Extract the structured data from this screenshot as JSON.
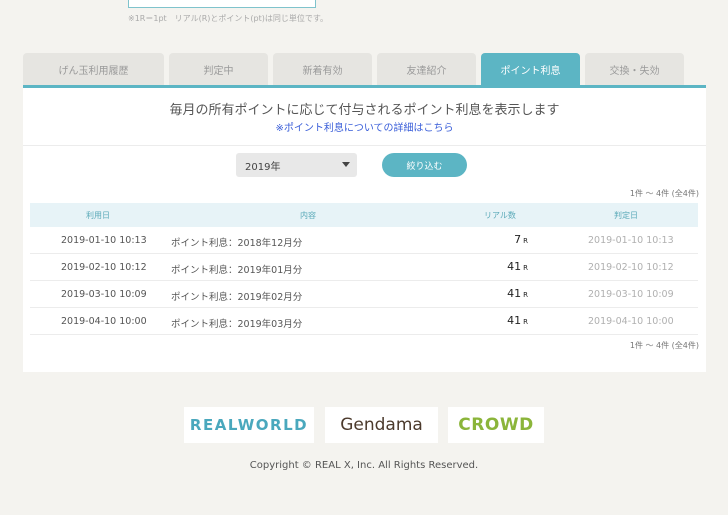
{
  "header": {
    "note": "※1R＝1pt　リアル(R)とポイント(pt)は同じ単位です。"
  },
  "tabs": [
    {
      "label": "げん玉利用履歴",
      "active": false
    },
    {
      "label": "判定中",
      "active": false
    },
    {
      "label": "新着有効",
      "active": false
    },
    {
      "label": "友達紹介",
      "active": false
    },
    {
      "label": "ポイント利息",
      "active": true
    },
    {
      "label": "交換・失効",
      "active": false
    }
  ],
  "panel": {
    "title": "毎月の所有ポイントに応じて付与されるポイント利息を表示します",
    "link": "※ポイント利息についての詳細はこちら"
  },
  "filter": {
    "year_value": "2019年",
    "button_label": "絞り込む"
  },
  "count_label": "1件 〜 4件 (全4件)",
  "table": {
    "headers": [
      "利用日",
      "内容",
      "リアル数",
      "判定日"
    ],
    "unit": "R",
    "rows": [
      {
        "date": "2019-01-10 10:13",
        "desc": "ポイント利息：2018年12月分",
        "points": "7",
        "judge_date": "2019-01-10 10:13"
      },
      {
        "date": "2019-02-10 10:12",
        "desc": "ポイント利息：2019年01月分",
        "points": "41",
        "judge_date": "2019-02-10 10:12"
      },
      {
        "date": "2019-03-10 10:09",
        "desc": "ポイント利息：2019年02月分",
        "points": "41",
        "judge_date": "2019-03-10 10:09"
      },
      {
        "date": "2019-04-10 10:00",
        "desc": "ポイント利息：2019年03月分",
        "points": "41",
        "judge_date": "2019-04-10 10:00"
      }
    ]
  },
  "footer": {
    "logos": [
      "REALWORLD",
      "Gendama",
      "CROWD"
    ],
    "copyright": "Copyright © REAL X, Inc. All Rights Reserved."
  },
  "colors": {
    "accent": "#5cb5c4",
    "link": "#3b5fd9",
    "background": "#f4f3ef"
  }
}
